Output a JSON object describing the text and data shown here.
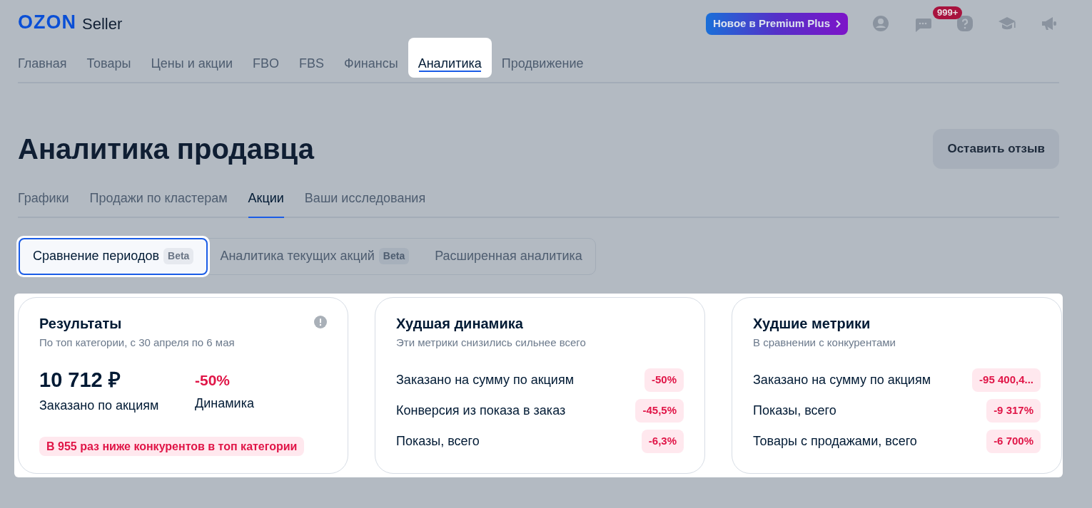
{
  "header": {
    "logo": {
      "brand": "OZON",
      "product": "Seller"
    },
    "promo": "Новое в Premium Plus",
    "chat_badge": "999+"
  },
  "nav": [
    {
      "label": "Главная",
      "selected": false,
      "spotlight": false
    },
    {
      "label": "Товары",
      "selected": false,
      "spotlight": false
    },
    {
      "label": "Цены и акции",
      "selected": false,
      "spotlight": false
    },
    {
      "label": "FBO",
      "selected": false,
      "spotlight": false
    },
    {
      "label": "FBS",
      "selected": false,
      "spotlight": false
    },
    {
      "label": "Финансы",
      "selected": false,
      "spotlight": false
    },
    {
      "label": "Аналитика",
      "selected": true,
      "spotlight": true
    },
    {
      "label": "Продвижение",
      "selected": false,
      "spotlight": false
    }
  ],
  "page": {
    "title": "Аналитика продавца",
    "feedback_button": "Оставить отзыв"
  },
  "subtabs": [
    {
      "label": "Графики",
      "selected": false
    },
    {
      "label": "Продажи по кластерам",
      "selected": false
    },
    {
      "label": "Акции",
      "selected": true
    },
    {
      "label": "Ваши исследования",
      "selected": false
    }
  ],
  "segments": [
    {
      "label": "Сравнение периодов",
      "badge": "Beta",
      "selected": true,
      "spotlight": true
    },
    {
      "label": "Аналитика текущих акций",
      "badge": "Beta",
      "selected": false,
      "spotlight": false
    },
    {
      "label": "Расширенная аналитика",
      "selected": false,
      "spotlight": false
    }
  ],
  "cards_spotlight": true,
  "cards": [
    {
      "kind": "summary",
      "title": "Результаты",
      "subtitle": "По топ категории, с 30 апреля по 6 мая",
      "stats": [
        {
          "value": "10 712 ₽",
          "label": "Заказано по акциям",
          "negative": false
        },
        {
          "value": "-50%",
          "label": "Динамика",
          "negative": true
        }
      ],
      "alert": "В 955 раз ниже конкурентов в топ категории"
    },
    {
      "kind": "list",
      "title": "Худшая динамика",
      "subtitle": "Эти метрики снизились сильнее всего",
      "rows": [
        {
          "label": "Заказано на сумму по акциям",
          "value": "-50%"
        },
        {
          "label": "Конверсия из показа в заказ",
          "value": "-45,5%"
        },
        {
          "label": "Показы, всего",
          "value": "-6,3%"
        }
      ]
    },
    {
      "kind": "list",
      "title": "Худшие метрики",
      "subtitle": "В сравнении с конкурентами",
      "rows": [
        {
          "label": "Заказано на сумму по акциям",
          "value": "-95 400,4..."
        },
        {
          "label": "Показы, всего",
          "value": "-9 317%"
        },
        {
          "label": "Товары с продажами, всего",
          "value": "-6 700%"
        }
      ]
    }
  ]
}
